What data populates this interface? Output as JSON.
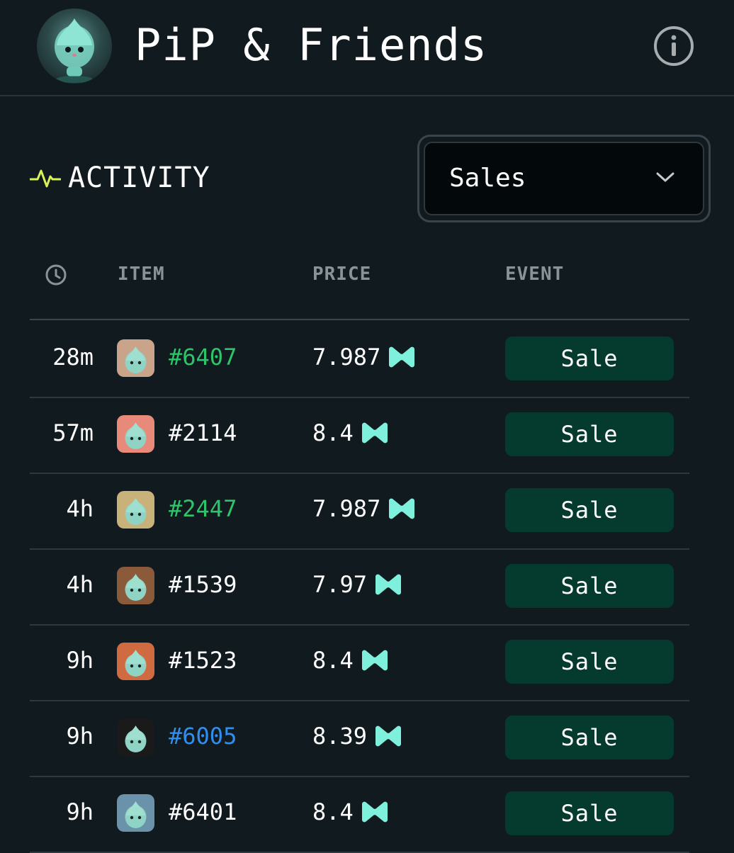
{
  "header": {
    "title": "PiP & Friends",
    "avatar_icon": "pip-mascot-avatar",
    "info_icon": "info-icon"
  },
  "activity": {
    "label": "ACTIVITY",
    "icon": "pulse-icon",
    "accent_color": "#d8f25a"
  },
  "filter": {
    "selected": "Sales",
    "icon": "chevron-down-icon"
  },
  "table": {
    "columns": {
      "time_icon": "clock-icon",
      "item": "ITEM",
      "price": "PRICE",
      "event": "EVENT"
    },
    "currency_icon": "sui-token-icon",
    "rows": [
      {
        "time": "28m",
        "item": "#6407",
        "item_color": "#2fc46a",
        "price": "7.987",
        "event": "Sale",
        "thumb_bg": "#c9a48a"
      },
      {
        "time": "57m",
        "item": "#2114",
        "item_color": "#ffffff",
        "price": "8.4",
        "event": "Sale",
        "thumb_bg": "#e88a7a"
      },
      {
        "time": "4h",
        "item": "#2447",
        "item_color": "#2fc46a",
        "price": "7.987",
        "event": "Sale",
        "thumb_bg": "#c8b27a"
      },
      {
        "time": "4h",
        "item": "#1539",
        "item_color": "#ffffff",
        "price": "7.97",
        "event": "Sale",
        "thumb_bg": "#8a5a3a"
      },
      {
        "time": "9h",
        "item": "#1523",
        "item_color": "#ffffff",
        "price": "8.4",
        "event": "Sale",
        "thumb_bg": "#d06a40"
      },
      {
        "time": "9h",
        "item": "#6005",
        "item_color": "#2f8ff0",
        "price": "8.39",
        "event": "Sale",
        "thumb_bg": "#1a1a1a"
      },
      {
        "time": "9h",
        "item": "#6401",
        "item_color": "#ffffff",
        "price": "8.4",
        "event": "Sale",
        "thumb_bg": "#6a92aa"
      }
    ]
  },
  "colors": {
    "background": "#101a1f",
    "sale_button": "#053b2e",
    "token": "#7ff0dc"
  }
}
